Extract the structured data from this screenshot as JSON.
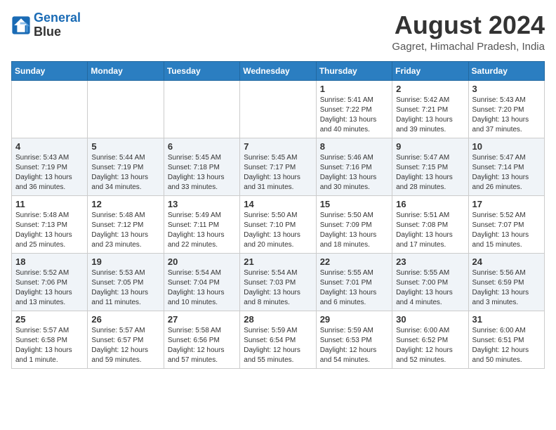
{
  "logo": {
    "line1": "General",
    "line2": "Blue"
  },
  "header": {
    "month_year": "August 2024",
    "location": "Gagret, Himachal Pradesh, India"
  },
  "days_of_week": [
    "Sunday",
    "Monday",
    "Tuesday",
    "Wednesday",
    "Thursday",
    "Friday",
    "Saturday"
  ],
  "weeks": [
    [
      {
        "day": "",
        "detail": ""
      },
      {
        "day": "",
        "detail": ""
      },
      {
        "day": "",
        "detail": ""
      },
      {
        "day": "",
        "detail": ""
      },
      {
        "day": "1",
        "detail": "Sunrise: 5:41 AM\nSunset: 7:22 PM\nDaylight: 13 hours\nand 40 minutes."
      },
      {
        "day": "2",
        "detail": "Sunrise: 5:42 AM\nSunset: 7:21 PM\nDaylight: 13 hours\nand 39 minutes."
      },
      {
        "day": "3",
        "detail": "Sunrise: 5:43 AM\nSunset: 7:20 PM\nDaylight: 13 hours\nand 37 minutes."
      }
    ],
    [
      {
        "day": "4",
        "detail": "Sunrise: 5:43 AM\nSunset: 7:19 PM\nDaylight: 13 hours\nand 36 minutes."
      },
      {
        "day": "5",
        "detail": "Sunrise: 5:44 AM\nSunset: 7:19 PM\nDaylight: 13 hours\nand 34 minutes."
      },
      {
        "day": "6",
        "detail": "Sunrise: 5:45 AM\nSunset: 7:18 PM\nDaylight: 13 hours\nand 33 minutes."
      },
      {
        "day": "7",
        "detail": "Sunrise: 5:45 AM\nSunset: 7:17 PM\nDaylight: 13 hours\nand 31 minutes."
      },
      {
        "day": "8",
        "detail": "Sunrise: 5:46 AM\nSunset: 7:16 PM\nDaylight: 13 hours\nand 30 minutes."
      },
      {
        "day": "9",
        "detail": "Sunrise: 5:47 AM\nSunset: 7:15 PM\nDaylight: 13 hours\nand 28 minutes."
      },
      {
        "day": "10",
        "detail": "Sunrise: 5:47 AM\nSunset: 7:14 PM\nDaylight: 13 hours\nand 26 minutes."
      }
    ],
    [
      {
        "day": "11",
        "detail": "Sunrise: 5:48 AM\nSunset: 7:13 PM\nDaylight: 13 hours\nand 25 minutes."
      },
      {
        "day": "12",
        "detail": "Sunrise: 5:48 AM\nSunset: 7:12 PM\nDaylight: 13 hours\nand 23 minutes."
      },
      {
        "day": "13",
        "detail": "Sunrise: 5:49 AM\nSunset: 7:11 PM\nDaylight: 13 hours\nand 22 minutes."
      },
      {
        "day": "14",
        "detail": "Sunrise: 5:50 AM\nSunset: 7:10 PM\nDaylight: 13 hours\nand 20 minutes."
      },
      {
        "day": "15",
        "detail": "Sunrise: 5:50 AM\nSunset: 7:09 PM\nDaylight: 13 hours\nand 18 minutes."
      },
      {
        "day": "16",
        "detail": "Sunrise: 5:51 AM\nSunset: 7:08 PM\nDaylight: 13 hours\nand 17 minutes."
      },
      {
        "day": "17",
        "detail": "Sunrise: 5:52 AM\nSunset: 7:07 PM\nDaylight: 13 hours\nand 15 minutes."
      }
    ],
    [
      {
        "day": "18",
        "detail": "Sunrise: 5:52 AM\nSunset: 7:06 PM\nDaylight: 13 hours\nand 13 minutes."
      },
      {
        "day": "19",
        "detail": "Sunrise: 5:53 AM\nSunset: 7:05 PM\nDaylight: 13 hours\nand 11 minutes."
      },
      {
        "day": "20",
        "detail": "Sunrise: 5:54 AM\nSunset: 7:04 PM\nDaylight: 13 hours\nand 10 minutes."
      },
      {
        "day": "21",
        "detail": "Sunrise: 5:54 AM\nSunset: 7:03 PM\nDaylight: 13 hours\nand 8 minutes."
      },
      {
        "day": "22",
        "detail": "Sunrise: 5:55 AM\nSunset: 7:01 PM\nDaylight: 13 hours\nand 6 minutes."
      },
      {
        "day": "23",
        "detail": "Sunrise: 5:55 AM\nSunset: 7:00 PM\nDaylight: 13 hours\nand 4 minutes."
      },
      {
        "day": "24",
        "detail": "Sunrise: 5:56 AM\nSunset: 6:59 PM\nDaylight: 13 hours\nand 3 minutes."
      }
    ],
    [
      {
        "day": "25",
        "detail": "Sunrise: 5:57 AM\nSunset: 6:58 PM\nDaylight: 13 hours\nand 1 minute."
      },
      {
        "day": "26",
        "detail": "Sunrise: 5:57 AM\nSunset: 6:57 PM\nDaylight: 12 hours\nand 59 minutes."
      },
      {
        "day": "27",
        "detail": "Sunrise: 5:58 AM\nSunset: 6:56 PM\nDaylight: 12 hours\nand 57 minutes."
      },
      {
        "day": "28",
        "detail": "Sunrise: 5:59 AM\nSunset: 6:54 PM\nDaylight: 12 hours\nand 55 minutes."
      },
      {
        "day": "29",
        "detail": "Sunrise: 5:59 AM\nSunset: 6:53 PM\nDaylight: 12 hours\nand 54 minutes."
      },
      {
        "day": "30",
        "detail": "Sunrise: 6:00 AM\nSunset: 6:52 PM\nDaylight: 12 hours\nand 52 minutes."
      },
      {
        "day": "31",
        "detail": "Sunrise: 6:00 AM\nSunset: 6:51 PM\nDaylight: 12 hours\nand 50 minutes."
      }
    ]
  ]
}
